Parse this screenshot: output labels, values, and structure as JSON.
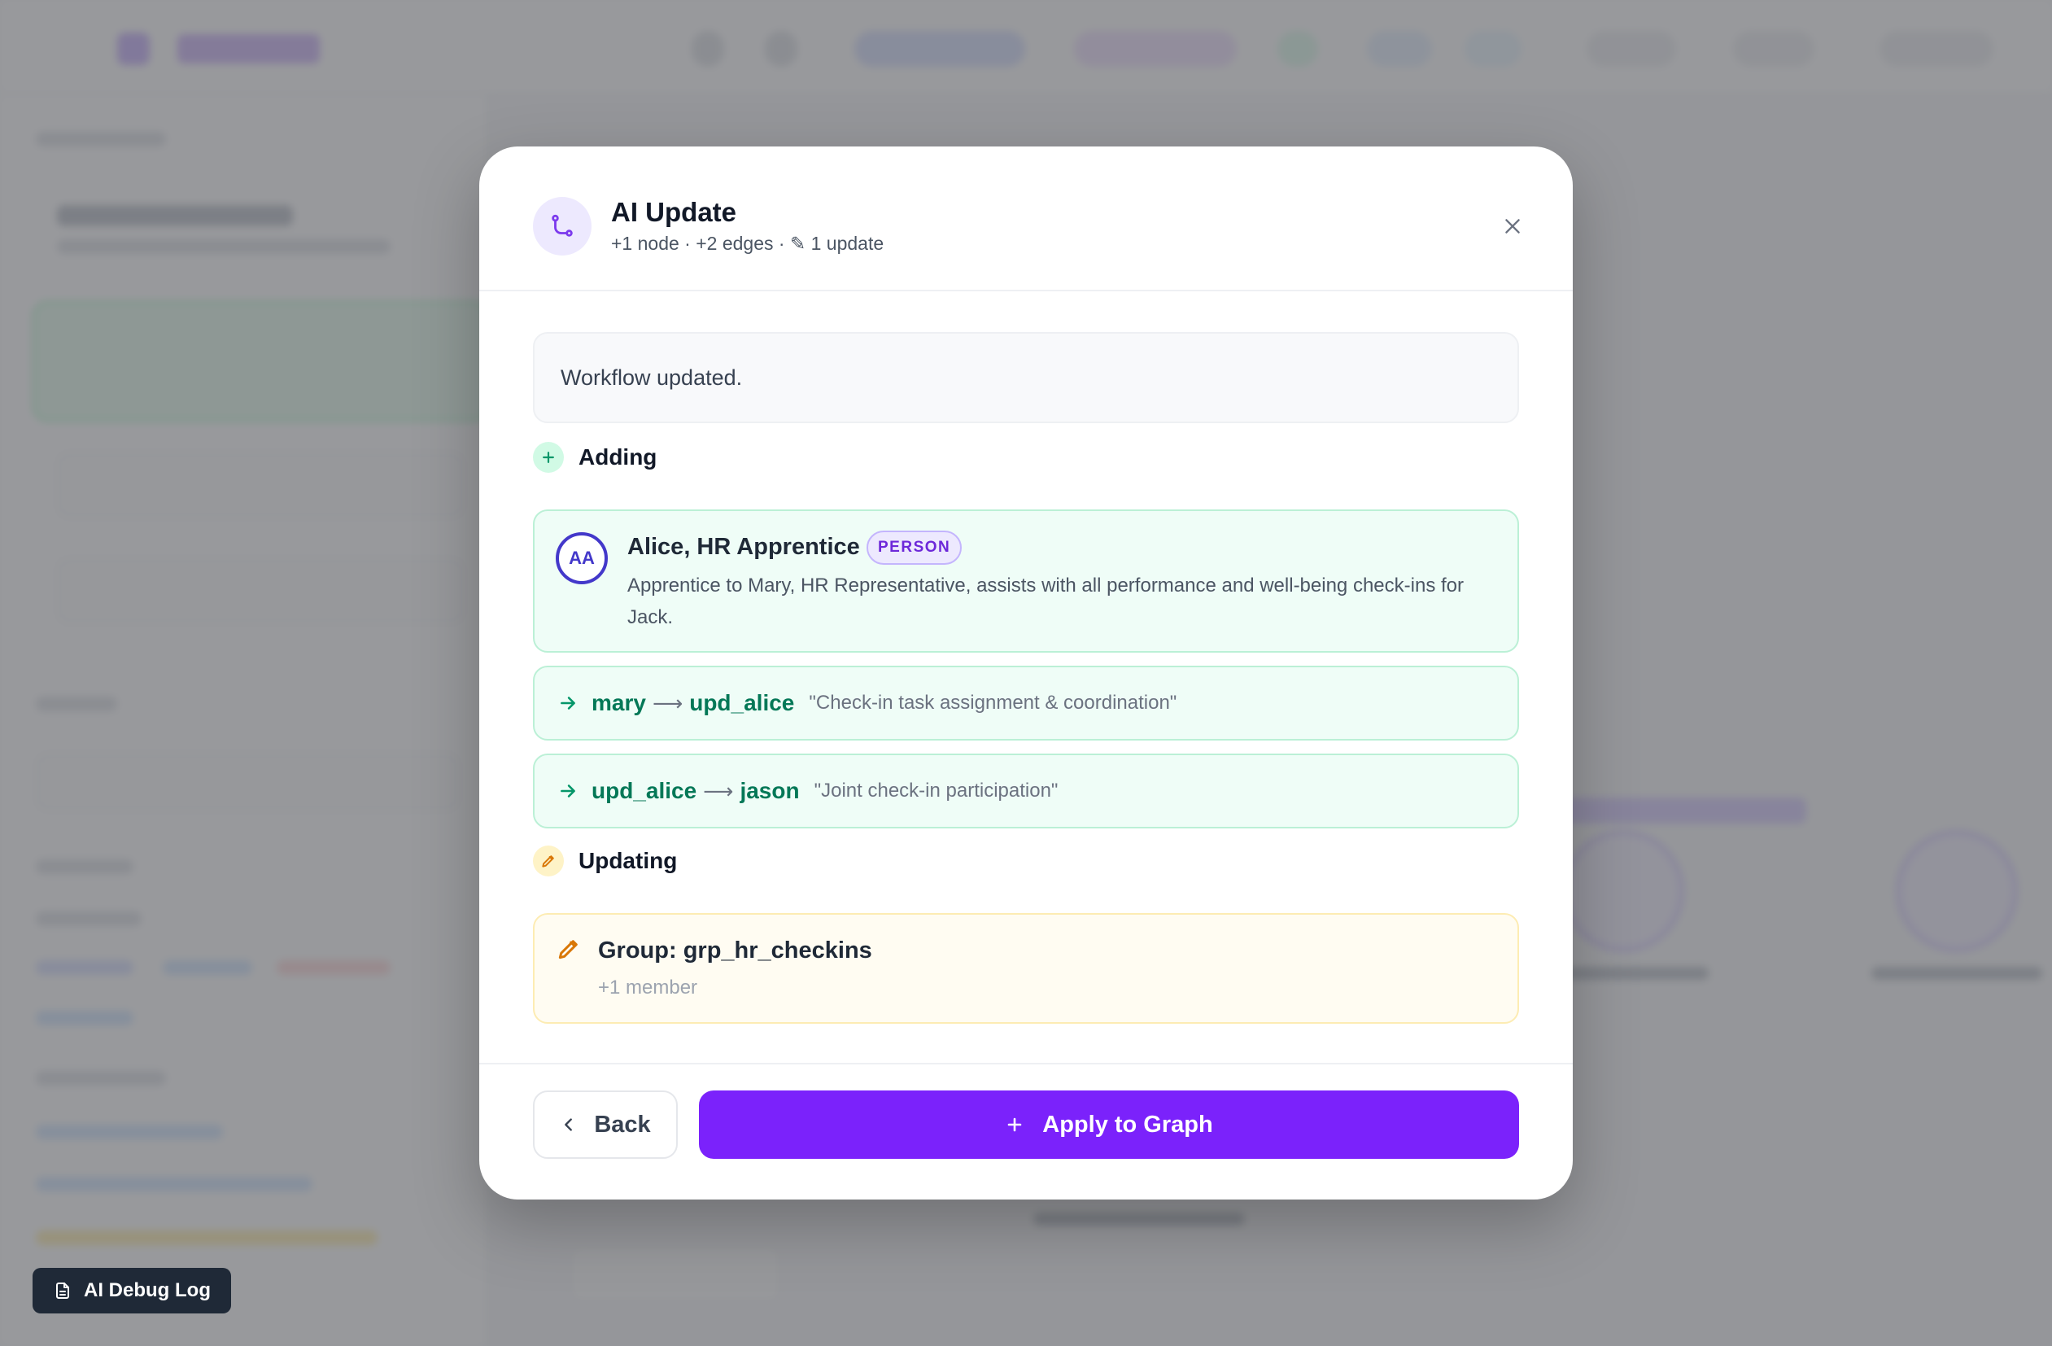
{
  "modal": {
    "title": "AI Update",
    "subtitle": "+1 node · +2 edges · ✎ 1 update",
    "summary": "Workflow updated.",
    "adding": {
      "heading": "Adding",
      "node": {
        "initials": "AA",
        "name": "Alice, HR Apprentice",
        "type": "PERSON",
        "description": "Apprentice to Mary, HR Representative, assists with all performance and well-being check-ins for Jack."
      },
      "edges": [
        {
          "from": "mary",
          "arrow": "⟶",
          "to": "upd_alice",
          "label": "\"Check-in task assignment & coordination\""
        },
        {
          "from": "upd_alice",
          "arrow": "⟶",
          "to": "jason",
          "label": "\"Joint check-in participation\""
        }
      ]
    },
    "updating": {
      "heading": "Updating",
      "item": {
        "title": "Group: grp_hr_checkins",
        "detail": "+1 member"
      }
    },
    "footer": {
      "back_label": "Back",
      "apply_label": "Apply to Graph"
    }
  },
  "debug": {
    "label": "AI Debug Log"
  },
  "colors": {
    "accent": "#7b22fb",
    "adding_bg": "#effdf7",
    "adding_text": "#047857",
    "updating_bg": "#fffcf2",
    "updating_icon": "#d97706",
    "person_ring": "#4338ca"
  },
  "icons": {
    "header": "workflow-branch-icon",
    "close": "close-icon",
    "adding": "plus-icon",
    "edge": "arrow-right-icon",
    "updating": "pencil-icon",
    "back": "chevron-left-icon",
    "apply": "plus-icon",
    "debug": "document-icon"
  }
}
